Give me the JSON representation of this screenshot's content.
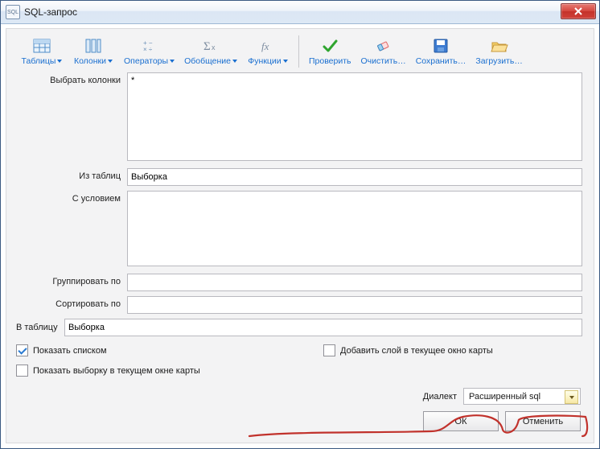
{
  "window": {
    "title": "SQL-запрос"
  },
  "toolbar": {
    "tables": "Таблицы",
    "columns": "Колонки",
    "operators": "Операторы",
    "aggregate": "Обобщение",
    "functions": "Функции",
    "check": "Проверить",
    "clear": "Очистить…",
    "save": "Сохранить…",
    "load": "Загрузить…"
  },
  "labels": {
    "select": "Выбрать колонки",
    "from": "Из таблиц",
    "where": "С условием",
    "groupby": "Группировать по",
    "orderby": "Сортировать по",
    "into": "В таблицу",
    "showlist": "Показать списком",
    "addlayer": "Добавить слой в текущее окно карты",
    "showsel": "Показать выборку в текущем окне карты",
    "dialect": "Диалект",
    "ok": "ОК",
    "cancel": "Отменить"
  },
  "values": {
    "select": "*",
    "from": "Выборка",
    "where": "",
    "groupby": "",
    "orderby": "",
    "into": "Выборка",
    "showlist_checked": true,
    "addlayer_checked": false,
    "showsel_checked": false,
    "dialect": "Расширенный sql"
  }
}
